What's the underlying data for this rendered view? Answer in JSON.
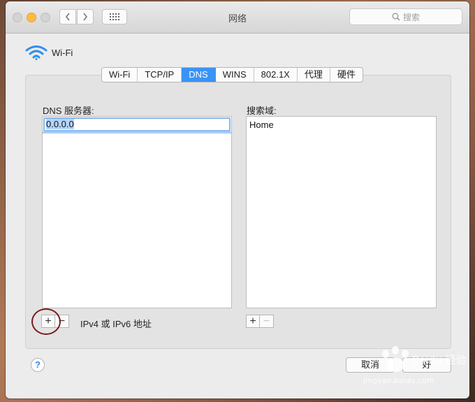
{
  "window": {
    "title": "网络",
    "search_placeholder": "搜索"
  },
  "header": {
    "service_name": "Wi-Fi"
  },
  "tabs": [
    {
      "label": "Wi-Fi",
      "active": false
    },
    {
      "label": "TCP/IP",
      "active": false
    },
    {
      "label": "DNS",
      "active": true
    },
    {
      "label": "WINS",
      "active": false
    },
    {
      "label": "802.1X",
      "active": false
    },
    {
      "label": "代理",
      "active": false
    },
    {
      "label": "硬件",
      "active": false
    }
  ],
  "dns": {
    "label": "DNS 服务器:",
    "entries": [
      "0.0.0.0"
    ],
    "hint": "IPv4 或 IPv6 地址"
  },
  "search_domains": {
    "label": "搜索域:",
    "entries": [
      "Home"
    ]
  },
  "buttons": {
    "add": "+",
    "remove": "−",
    "help": "?",
    "cancel": "取消",
    "ok": "好"
  },
  "watermark": {
    "brand": "Baidu 经验",
    "url": "jingyan.baidu.com"
  },
  "colors": {
    "accent": "#3b93f5",
    "annotation_circle": "#7a1a1a"
  }
}
